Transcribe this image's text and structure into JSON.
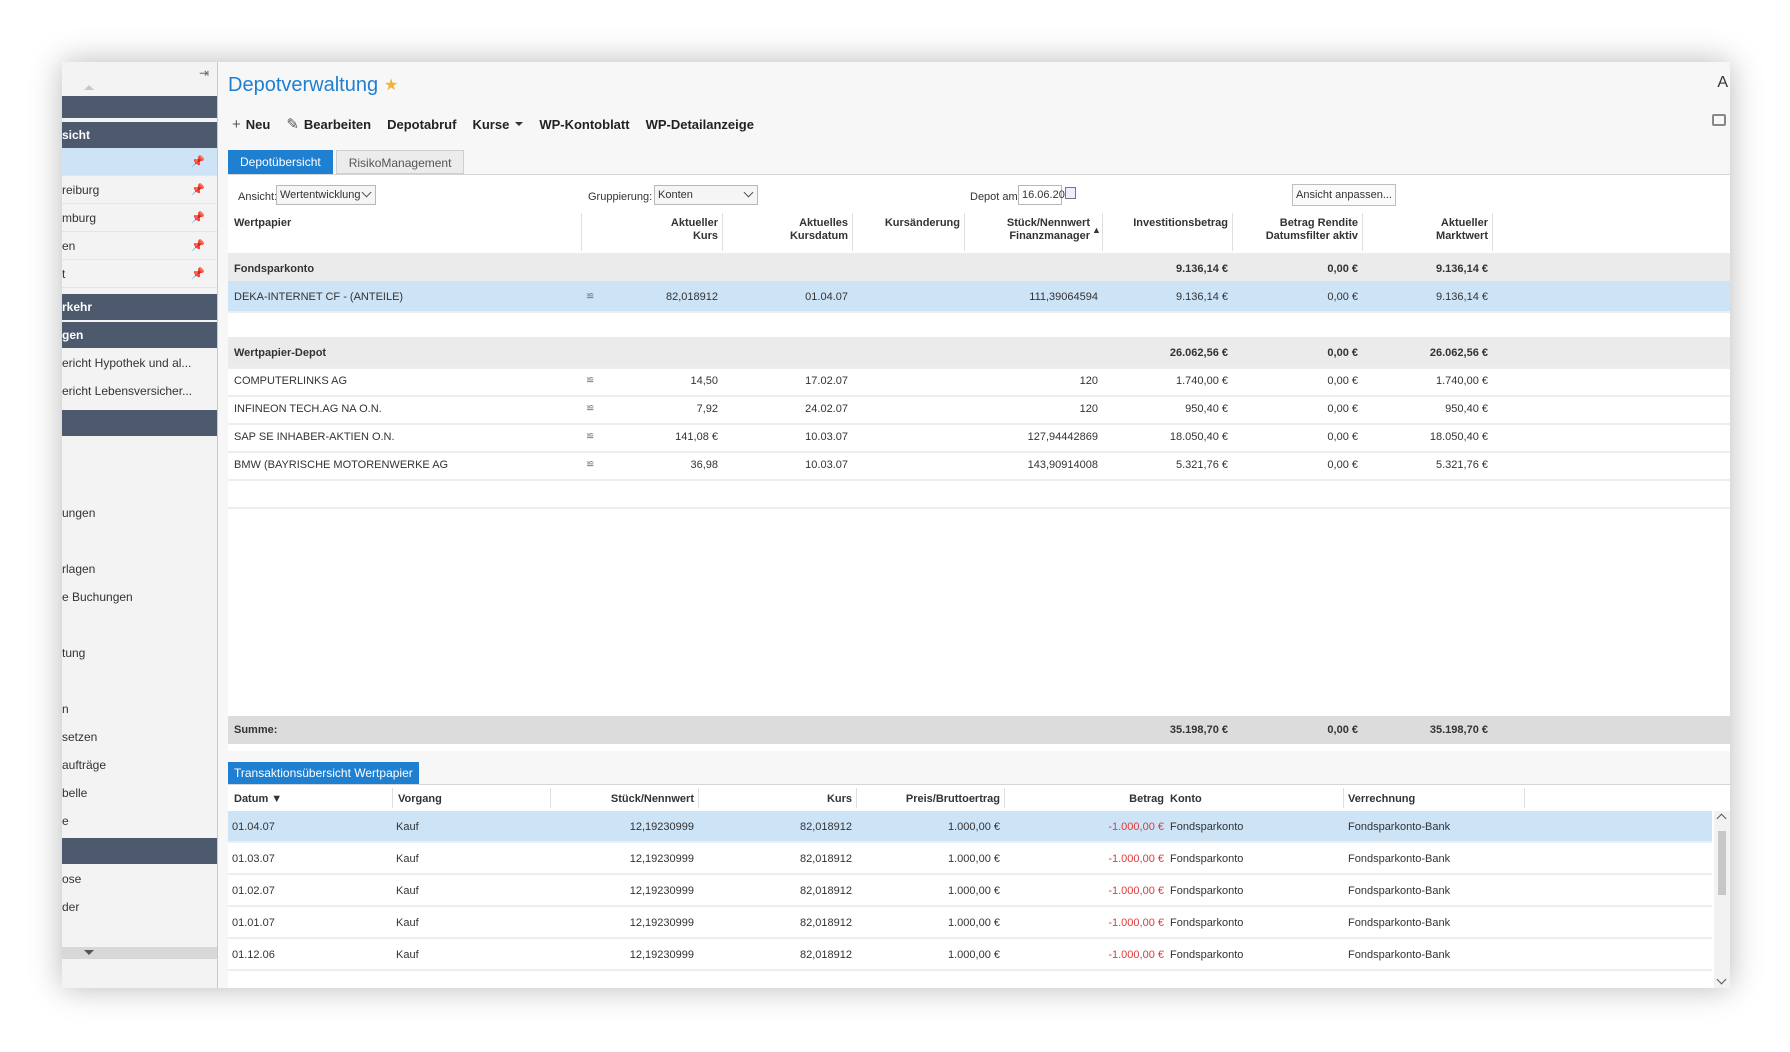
{
  "app": {
    "title": "Depotverwaltung",
    "top_right_char": "A"
  },
  "sidebar": {
    "header_sicht": "sicht",
    "items_a": [
      {
        "label": ""
      },
      {
        "label": "reiburg"
      },
      {
        "label": "mburg"
      },
      {
        "label": "en"
      },
      {
        "label": "t"
      }
    ],
    "header_rkehr": "rkehr",
    "header_gen": "gen",
    "items_b": [
      {
        "label": "ericht Hypothek und al..."
      },
      {
        "label": "ericht Lebensversicher..."
      }
    ],
    "items_c": [
      {
        "label": "ungen"
      },
      {
        "label": "rlagen"
      },
      {
        "label": "e Buchungen"
      },
      {
        "label": "tung"
      },
      {
        "label": "n"
      },
      {
        "label": "setzen"
      },
      {
        "label": "aufträge"
      },
      {
        "label": "belle"
      },
      {
        "label": "e"
      }
    ],
    "items_d": [
      {
        "label": "ose"
      },
      {
        "label": "der"
      }
    ]
  },
  "toolbar": {
    "new": "Neu",
    "edit": "Bearbeiten",
    "depotabruf": "Depotabruf",
    "kurse": "Kurse",
    "wp_kontoblatt": "WP-Kontoblatt",
    "wp_detail": "WP-Detailanzeige"
  },
  "tabs": [
    "Depotübersicht",
    "RisikoManagement"
  ],
  "controls": {
    "ansicht_label": "Ansicht:",
    "ansicht_value": "Wertentwicklung",
    "gruppierung_label": "Gruppierung:",
    "gruppierung_value": "Konten",
    "depot_label": "Depot am:",
    "depot_value": "16.06.20",
    "ansicht_button": "Ansicht anpassen..."
  },
  "columns": {
    "wertpapier": "Wertpapier",
    "kurs_1": "Aktueller",
    "kurs_2": "Kurs",
    "datum_1": "Aktuelles",
    "datum_2": "Kursdatum",
    "aenderung": "Kursänderung",
    "stueck_1": "Stück/Nennwert",
    "stueck_2": "Finanzmanager",
    "invest": "Investitionsbetrag",
    "rendite_1": "Betrag Rendite",
    "rendite_2": "Datumsfilter aktiv",
    "markt_1": "Aktueller",
    "markt_2": "Marktwert"
  },
  "groups": [
    {
      "name": "Fondsparkonto",
      "invest": "9.136,14 €",
      "rendite": "0,00 €",
      "markt": "9.136,14 €",
      "rows": [
        {
          "name": "DEKA-INTERNET CF - (ANTEILE)",
          "kurs": "82,018912",
          "datum": "01.04.07",
          "aenderung": "",
          "stueck": "111,39064594",
          "invest": "9.136,14 €",
          "rendite": "0,00 €",
          "markt": "9.136,14 €"
        }
      ]
    },
    {
      "name": "Wertpapier-Depot",
      "invest": "26.062,56 €",
      "rendite": "0,00 €",
      "markt": "26.062,56 €",
      "rows": [
        {
          "name": "COMPUTERLINKS AG",
          "kurs": "14,50",
          "datum": "17.02.07",
          "aenderung": "",
          "stueck": "120",
          "invest": "1.740,00 €",
          "rendite": "0,00 €",
          "markt": "1.740,00 €"
        },
        {
          "name": "INFINEON TECH.AG NA O.N.",
          "kurs": "7,92",
          "datum": "24.02.07",
          "aenderung": "",
          "stueck": "120",
          "invest": "950,40 €",
          "rendite": "0,00 €",
          "markt": "950,40 €"
        },
        {
          "name": "SAP SE INHABER-AKTIEN O.N.",
          "kurs": "141,08 €",
          "datum": "10.03.07",
          "aenderung": "",
          "stueck": "127,94442869",
          "invest": "18.050,40 €",
          "rendite": "0,00 €",
          "markt": "18.050,40 €"
        },
        {
          "name": "BMW (BAYRISCHE MOTORENWERKE AG",
          "kurs": "36,98",
          "datum": "10.03.07",
          "aenderung": "",
          "stueck": "143,90914008",
          "invest": "5.321,76 €",
          "rendite": "0,00 €",
          "markt": "5.321,76 €"
        }
      ]
    }
  ],
  "summe": {
    "label": "Summe:",
    "invest": "35.198,70 €",
    "rendite": "0,00 €",
    "markt": "35.198,70 €"
  },
  "transactions": {
    "tab": "Transaktionsübersicht Wertpapier",
    "columns": {
      "datum": "Datum",
      "vorgang": "Vorgang",
      "stueck": "Stück/Nennwert",
      "kurs": "Kurs",
      "preis": "Preis/Bruttoertrag",
      "betrag": "Betrag",
      "konto": "Konto",
      "verrechnung": "Verrechnung"
    },
    "rows": [
      {
        "datum": "01.04.07",
        "vorgang": "Kauf",
        "stueck": "12,19230999",
        "kurs": "82,018912",
        "preis": "1.000,00 €",
        "betrag": "-1.000,00 €",
        "konto": "Fondsparkonto",
        "verrechnung": "Fondsparkonto-Bank"
      },
      {
        "datum": "01.03.07",
        "vorgang": "Kauf",
        "stueck": "12,19230999",
        "kurs": "82,018912",
        "preis": "1.000,00 €",
        "betrag": "-1.000,00 €",
        "konto": "Fondsparkonto",
        "verrechnung": "Fondsparkonto-Bank"
      },
      {
        "datum": "01.02.07",
        "vorgang": "Kauf",
        "stueck": "12,19230999",
        "kurs": "82,018912",
        "preis": "1.000,00 €",
        "betrag": "-1.000,00 €",
        "konto": "Fondsparkonto",
        "verrechnung": "Fondsparkonto-Bank"
      },
      {
        "datum": "01.01.07",
        "vorgang": "Kauf",
        "stueck": "12,19230999",
        "kurs": "82,018912",
        "preis": "1.000,00 €",
        "betrag": "-1.000,00 €",
        "konto": "Fondsparkonto",
        "verrechnung": "Fondsparkonto-Bank"
      },
      {
        "datum": "01.12.06",
        "vorgang": "Kauf",
        "stueck": "12,19230999",
        "kurs": "82,018912",
        "preis": "1.000,00 €",
        "betrag": "-1.000,00 €",
        "konto": "Fondsparkonto",
        "verrechnung": "Fondsparkonto-Bank"
      }
    ]
  },
  "colors": {
    "accent": "#1f7fd1",
    "sidebar_block": "#4d5a6e",
    "selection": "#cde4f7",
    "negative": "#e03a3a",
    "star": "#f0b23a"
  }
}
